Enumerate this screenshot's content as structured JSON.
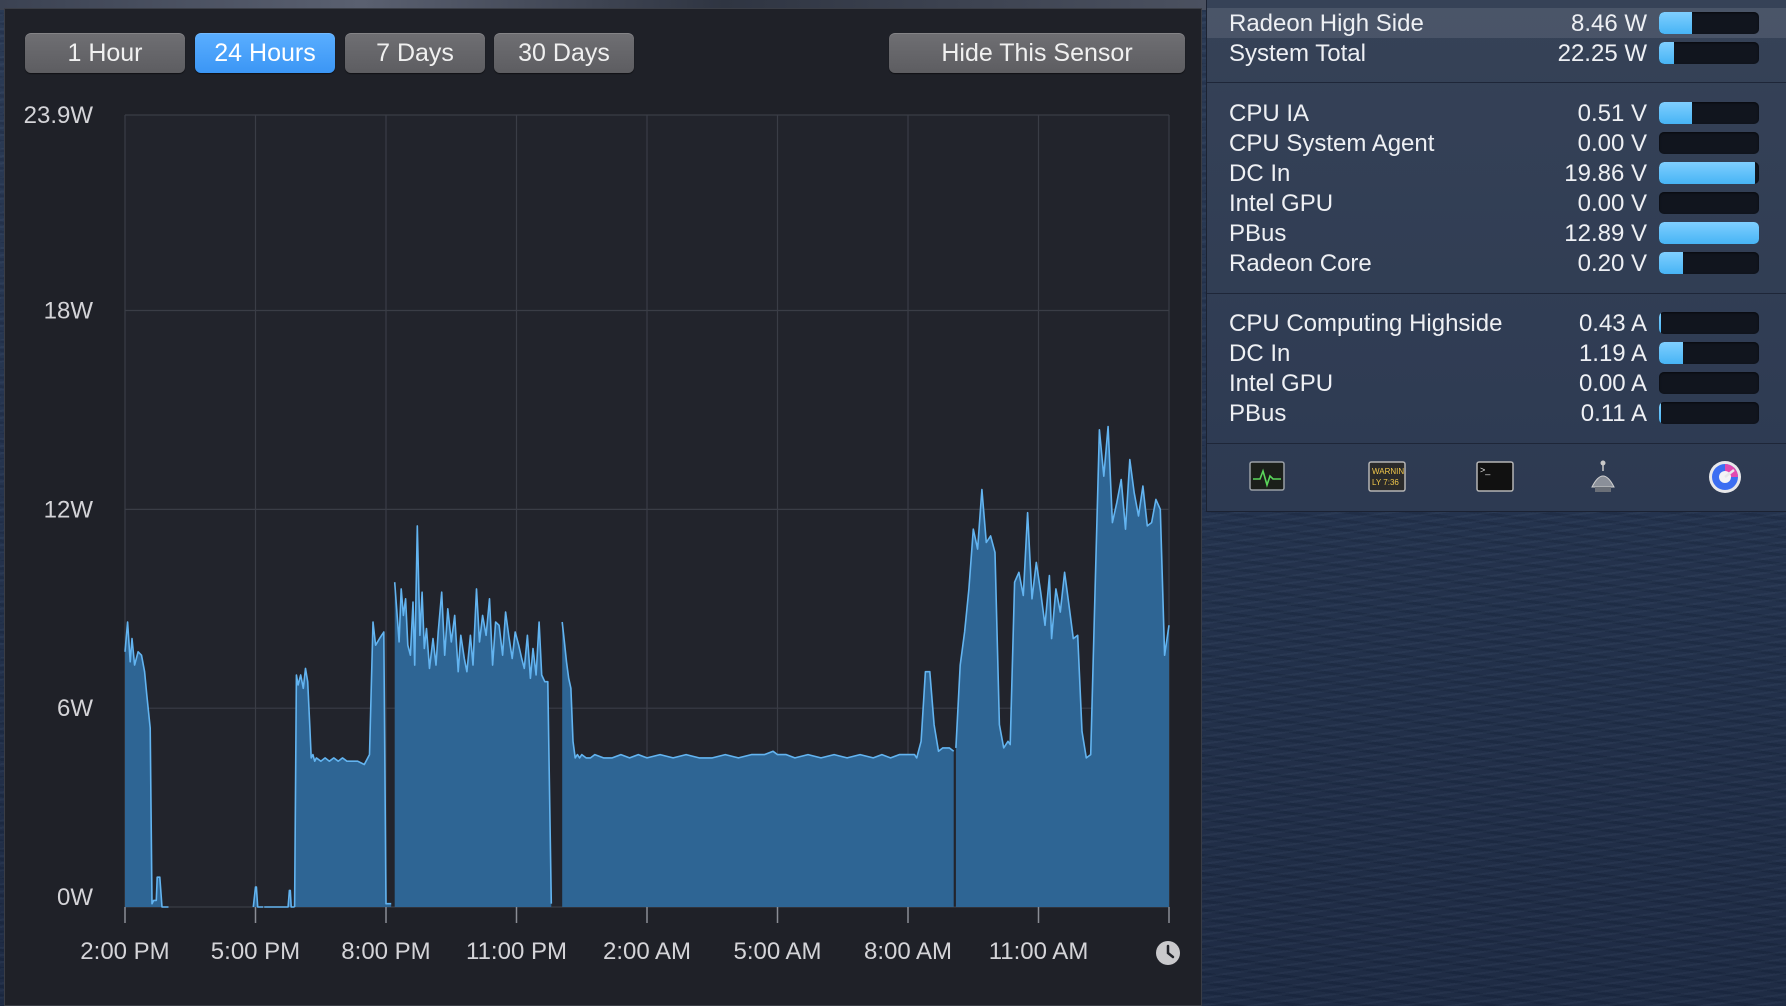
{
  "range_buttons": [
    {
      "label": "1 Hour"
    },
    {
      "label": "24 Hours"
    },
    {
      "label": "7 Days"
    },
    {
      "label": "30 Days"
    }
  ],
  "active_range": "24 Hours",
  "hide_button": "Hide This Sensor",
  "chart_data": {
    "type": "area",
    "ylim": [
      0,
      23.9
    ],
    "y_ticks": [
      "0W",
      "6W",
      "12W",
      "18W",
      "23.9W"
    ],
    "y_tick_values": [
      0,
      6,
      12,
      18,
      23.9
    ],
    "x_ticks": [
      "2:00 PM",
      "5:00 PM",
      "8:00 PM",
      "11:00 PM",
      "2:00 AM",
      "5:00 AM",
      "8:00 AM",
      "11:00 AM"
    ],
    "x_tick_hours": [
      0,
      3,
      6,
      9,
      12,
      15,
      18,
      21
    ],
    "xlim_hours": [
      0,
      24
    ],
    "color": "#2e6594",
    "line_color": "#63b4f0",
    "series": [
      {
        "hours": [
          0.0,
          0.06,
          0.12,
          0.16,
          0.22,
          0.3,
          0.38,
          0.45,
          0.5,
          0.58,
          0.62,
          0.66,
          0.72,
          0.74,
          0.8,
          0.85,
          0.95,
          1.0
        ],
        "values": [
          7.7,
          8.6,
          7.4,
          8.1,
          7.3,
          7.7,
          7.6,
          7.1,
          6.4,
          5.4,
          0.1,
          0.2,
          0.2,
          0.9,
          0.9,
          0.0,
          0.0,
          0.0
        ]
      },
      {
        "hours": [
          2.95,
          3.0,
          3.02,
          3.05,
          3.1,
          3.15,
          3.18
        ],
        "values": [
          0.0,
          0.6,
          0.6,
          0.0,
          0.0,
          0.0,
          0.0
        ]
      },
      {
        "hours": [
          3.2,
          3.25,
          3.27,
          3.3,
          3.35,
          3.4,
          3.75,
          3.78,
          3.8,
          3.82,
          3.87,
          3.9
        ],
        "values": [
          0.0,
          0.0,
          0.0,
          0.0,
          0.0,
          0.0,
          0.0,
          0.5,
          0.5,
          0.0,
          0.0,
          0.0
        ]
      },
      {
        "hours": [
          3.9,
          3.94,
          3.98,
          4.04,
          4.1,
          4.15,
          4.2,
          4.25,
          4.28,
          4.32,
          4.36,
          4.4,
          4.5,
          4.6,
          4.7,
          4.8,
          4.9,
          5.0,
          5.1,
          5.2,
          5.35,
          5.5,
          5.62,
          5.7,
          5.76,
          5.85,
          5.95,
          6.0,
          6.05,
          6.12
        ],
        "values": [
          0.0,
          7.0,
          6.7,
          7.0,
          6.6,
          7.2,
          6.8,
          5.4,
          4.5,
          4.6,
          4.4,
          4.5,
          4.4,
          4.5,
          4.4,
          4.5,
          4.4,
          4.5,
          4.4,
          4.4,
          4.4,
          4.3,
          4.6,
          8.6,
          7.9,
          8.1,
          8.3,
          0.1,
          0.1,
          0.1
        ]
      },
      {
        "hours": [
          6.2,
          6.3,
          6.35,
          6.4,
          6.45,
          6.5,
          6.56,
          6.62,
          6.66,
          6.72,
          6.78,
          6.83,
          6.88,
          6.93,
          7.0,
          7.08,
          7.15,
          7.2,
          7.28,
          7.35,
          7.42,
          7.5,
          7.58,
          7.66,
          7.72,
          7.8,
          7.86,
          7.94,
          8.0,
          8.08,
          8.15,
          8.22,
          8.3,
          8.38,
          8.45,
          8.52,
          8.6,
          8.68,
          8.75,
          8.82,
          8.9,
          8.97,
          9.05,
          9.12,
          9.18,
          9.25,
          9.32,
          9.38,
          9.45,
          9.52,
          9.58,
          9.65,
          9.72,
          9.8
        ],
        "values": [
          9.8,
          8.0,
          9.6,
          8.8,
          9.3,
          7.9,
          7.6,
          9.2,
          7.3,
          11.5,
          8.2,
          9.5,
          7.8,
          8.4,
          7.2,
          8.1,
          7.3,
          8.3,
          9.5,
          7.6,
          9.0,
          8.0,
          8.8,
          7.1,
          8.2,
          7.5,
          7.1,
          8.2,
          7.3,
          9.6,
          8.0,
          8.8,
          8.2,
          9.3,
          7.3,
          8.6,
          8.5,
          7.6,
          8.9,
          8.2,
          7.5,
          8.3,
          7.9,
          7.5,
          7.2,
          8.2,
          6.9,
          7.8,
          7.0,
          8.6,
          7.0,
          6.8,
          6.8,
          0.1
        ]
      },
      {
        "hours": [
          10.05,
          10.1,
          10.15,
          10.2,
          10.25,
          10.3,
          10.35,
          10.4,
          10.45,
          10.5,
          10.6,
          10.7,
          10.8,
          11.0,
          11.2,
          11.4,
          11.6,
          11.8,
          12.0,
          12.3,
          12.6,
          12.9,
          13.2,
          13.5,
          13.8,
          14.1,
          14.4,
          14.7,
          14.9,
          15.0,
          15.2,
          15.4,
          15.7,
          16.0,
          16.3,
          16.6,
          16.9,
          17.2,
          17.4,
          17.6,
          17.8,
          17.95,
          18.05,
          18.15,
          18.2,
          18.3,
          18.4,
          18.5,
          18.6,
          18.7,
          18.8,
          18.95,
          19.05
        ],
        "values": [
          8.6,
          8.0,
          7.4,
          6.9,
          6.6,
          5.0,
          4.5,
          4.6,
          4.5,
          4.6,
          4.5,
          4.5,
          4.6,
          4.5,
          4.5,
          4.6,
          4.5,
          4.6,
          4.5,
          4.6,
          4.5,
          4.6,
          4.5,
          4.5,
          4.6,
          4.5,
          4.6,
          4.6,
          4.7,
          4.6,
          4.6,
          4.5,
          4.6,
          4.5,
          4.6,
          4.5,
          4.6,
          4.5,
          4.6,
          4.5,
          4.6,
          4.6,
          4.6,
          4.6,
          4.5,
          5.0,
          7.1,
          7.1,
          5.5,
          4.7,
          4.8,
          4.8,
          4.7
        ]
      },
      {
        "hours": [
          19.1,
          19.2,
          19.3,
          19.4,
          19.5,
          19.6,
          19.7,
          19.8,
          19.9,
          20.0,
          20.1,
          20.2,
          20.3,
          20.35,
          20.45,
          20.55,
          20.65,
          20.75,
          20.85,
          20.95,
          21.05,
          21.15,
          21.25,
          21.3,
          21.4,
          21.5,
          21.6,
          21.7,
          21.8,
          21.9,
          22.0,
          22.1,
          22.2,
          22.3,
          22.4,
          22.5,
          22.6,
          22.7,
          22.8,
          22.9,
          23.0,
          23.1,
          23.2,
          23.3,
          23.4,
          23.5,
          23.6,
          23.7,
          23.8,
          23.9,
          24.0
        ],
        "values": [
          4.8,
          7.3,
          8.3,
          9.6,
          11.4,
          10.8,
          12.6,
          11.0,
          11.2,
          10.7,
          5.5,
          4.8,
          5.0,
          4.9,
          9.8,
          10.1,
          9.4,
          11.9,
          9.3,
          10.4,
          9.5,
          8.5,
          10.0,
          8.1,
          9.6,
          8.9,
          10.1,
          9.1,
          8.1,
          8.2,
          5.3,
          4.5,
          4.6,
          9.6,
          14.4,
          13.0,
          14.5,
          11.6,
          12.2,
          12.9,
          11.4,
          13.5,
          12.5,
          11.8,
          12.7,
          11.5,
          11.6,
          12.3,
          12.0,
          7.6,
          8.5
        ]
      }
    ]
  },
  "panel": {
    "power_rows": [
      {
        "label": "Radeon High Side",
        "value": "8.46 W",
        "fill": 0.33
      },
      {
        "label": "System Total",
        "value": "22.25 W",
        "fill": 0.15
      }
    ],
    "voltage_rows": [
      {
        "label": "CPU IA",
        "value": "0.51 V",
        "fill": 0.33
      },
      {
        "label": "CPU System Agent",
        "value": "0.00 V",
        "fill": 0.0
      },
      {
        "label": "DC In",
        "value": "19.86 V",
        "fill": 0.96
      },
      {
        "label": "Intel GPU",
        "value": "0.00 V",
        "fill": 0.0
      },
      {
        "label": "PBus",
        "value": "12.89 V",
        "fill": 1.0
      },
      {
        "label": "Radeon Core",
        "value": "0.20 V",
        "fill": 0.24
      }
    ],
    "current_rows": [
      {
        "label": "CPU Computing Highside",
        "value": "0.43 A",
        "fill": 0.02
      },
      {
        "label": "DC In",
        "value": "1.19 A",
        "fill": 0.24
      },
      {
        "label": "Intel GPU",
        "value": "0.00 A",
        "fill": 0.0
      },
      {
        "label": "PBus",
        "value": "0.11 A",
        "fill": 0.02
      }
    ],
    "toolbar": {
      "console_warning_text": "WARNIN",
      "console_time_text": "LY 7:36",
      "terminal_prompt": ">_"
    }
  }
}
